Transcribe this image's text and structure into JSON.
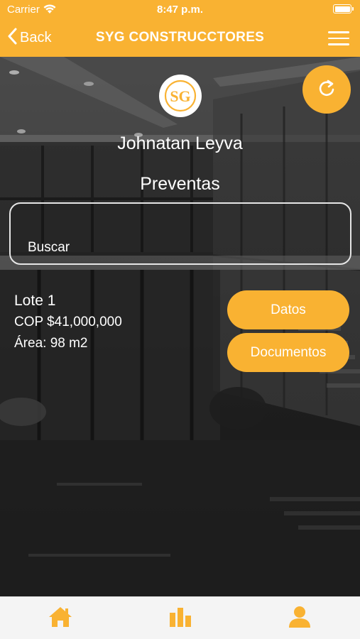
{
  "status_bar": {
    "carrier": "Carrier",
    "time": "8:47 p.m."
  },
  "nav": {
    "back_label": "Back",
    "title": "SYG CONSTRUCCTORES",
    "menu_icon": "hamburger-menu-icon"
  },
  "profile": {
    "logo_text": "SG",
    "name": "Johnatan Leyva",
    "section": "Preventas"
  },
  "search": {
    "placeholder": "Buscar",
    "value": ""
  },
  "lot": {
    "title": "Lote 1",
    "price": "COP $41,000,000",
    "area": "Área: 98 m2",
    "buttons": {
      "datos": "Datos",
      "documentos": "Documentos"
    }
  },
  "tabbar": {
    "items": [
      {
        "icon": "home-icon"
      },
      {
        "icon": "bar-chart-icon"
      },
      {
        "icon": "user-icon"
      }
    ]
  },
  "colors": {
    "accent": "#f9b232",
    "tabbar_bg": "#f4f4f4",
    "text": "#ffffff"
  }
}
